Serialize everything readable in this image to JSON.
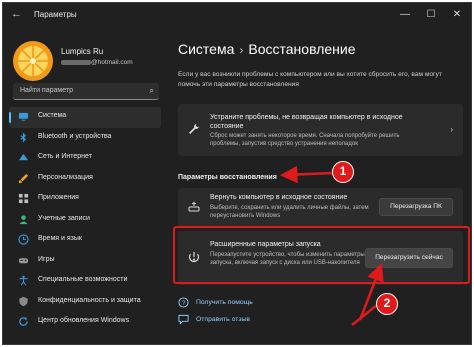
{
  "window": {
    "title": "Параметры",
    "back": "←",
    "minimize": "—",
    "maximize": "☐",
    "close": "✕"
  },
  "user": {
    "name": "Lumpics Ru",
    "email_suffix": "@hotmail.com"
  },
  "search": {
    "placeholder": "Найти параметр",
    "icon": "search-icon"
  },
  "nav": [
    {
      "label": "Система",
      "icon": "monitor-icon",
      "active": true
    },
    {
      "label": "Bluetooth и устройства",
      "icon": "bluetooth-icon"
    },
    {
      "label": "Сеть и Интернет",
      "icon": "wifi-icon"
    },
    {
      "label": "Персонализация",
      "icon": "brush-icon"
    },
    {
      "label": "Приложения",
      "icon": "apps-icon"
    },
    {
      "label": "Учетные записи",
      "icon": "person-icon"
    },
    {
      "label": "Время и язык",
      "icon": "globe-clock-icon"
    },
    {
      "label": "Игры",
      "icon": "gamepad-icon"
    },
    {
      "label": "Специальные возможности",
      "icon": "accessibility-icon"
    },
    {
      "label": "Конфиденциальность и защита",
      "icon": "shield-icon"
    },
    {
      "label": "Центр обновления Windows",
      "icon": "update-icon"
    }
  ],
  "breadcrumb": {
    "parent": "Система",
    "separator": "›",
    "current": "Восстановление"
  },
  "intro": "Если у вас возникли проблемы с компьютером или вы хотите сбросить его, вам могут помочь эти параметры восстановления",
  "troubleshoot": {
    "title": "Устраните проблемы, не возвращая компьютер в исходное состояние",
    "desc": "Сброс может занять некоторое время. Сначала попробуйте решить проблемы, запустив средство устранения неполадок"
  },
  "section": "Параметры восстановления",
  "reset": {
    "title": "Вернуть компьютер в исходное состояние",
    "desc": "Выберите, сохранить или удалить личные файлы, затем переустановить Windows",
    "button": "Перезагрузка ПК"
  },
  "advanced": {
    "title": "Расширенные параметры запуска",
    "desc": "Перезапустите устройство, чтобы изменить параметры запуска, включая запуск с диска или USB-накопителя",
    "button": "Перезагрузить сейчас"
  },
  "links": [
    {
      "label": "Получить помощь",
      "icon": "help-icon"
    },
    {
      "label": "Отправить отзыв",
      "icon": "feedback-icon"
    }
  ],
  "annotations": {
    "badge1": "1",
    "badge2": "2",
    "accent": "#e0191b"
  }
}
